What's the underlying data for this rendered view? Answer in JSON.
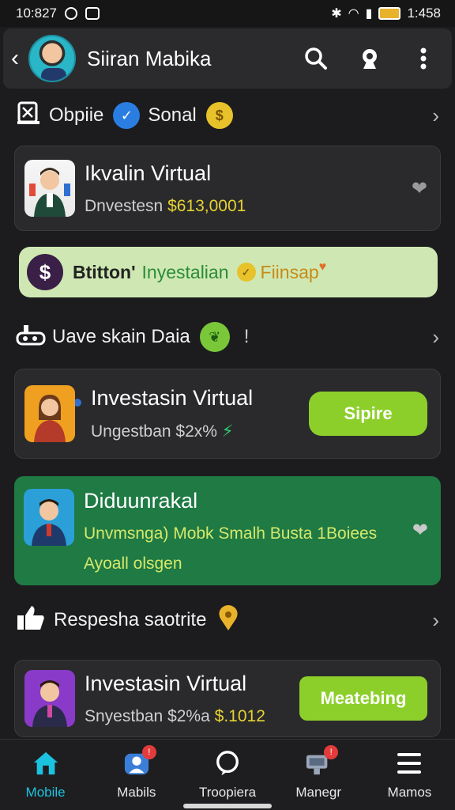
{
  "status_bar": {
    "time": "10:827",
    "right_time": "1:458"
  },
  "header": {
    "title": "Siiran Mabika"
  },
  "section1": {
    "label_a": "Obpiie",
    "label_b": "Sonal"
  },
  "card1": {
    "title": "Ikvalin Virtual",
    "sub_prefix": "Dnvestesn",
    "sub_value": "$613,0001"
  },
  "promo": {
    "dollar": "$",
    "p1": "Btitton'",
    "p2": "Inyestalian",
    "p3": "Fiinsap"
  },
  "section2": {
    "label": "Uave skain Daia"
  },
  "card2": {
    "title": "Investasin Virtual",
    "sub": "Ungestban $2x%",
    "button": "Sipire"
  },
  "card3": {
    "title": "Diduunrakal",
    "sub1": "Unvmsnga) Mobk Smalh Busta 1Boiees",
    "sub2": "Ayoall olsgen"
  },
  "section3": {
    "label": "Respesha saotrite"
  },
  "card4": {
    "title": "Investasin Virtual",
    "sub_prefix": "Snyestban $2%a",
    "sub_value": "$.1012",
    "button": "Meatebing"
  },
  "nav": [
    {
      "label": "Mobile",
      "icon": "home-icon",
      "badge": ""
    },
    {
      "label": "Mabils",
      "icon": "profile-icon",
      "badge": "!"
    },
    {
      "label": "Troopiera",
      "icon": "chat-icon",
      "badge": ""
    },
    {
      "label": "Manegr",
      "icon": "manager-icon",
      "badge": "!"
    },
    {
      "label": "Mamos",
      "icon": "menu-icon",
      "badge": ""
    }
  ],
  "colors": {
    "accent": "#1cc3e0",
    "button_green": "#8ccf2b",
    "card_green": "#1f7a44",
    "promo_bg": "#cfe8b3"
  }
}
